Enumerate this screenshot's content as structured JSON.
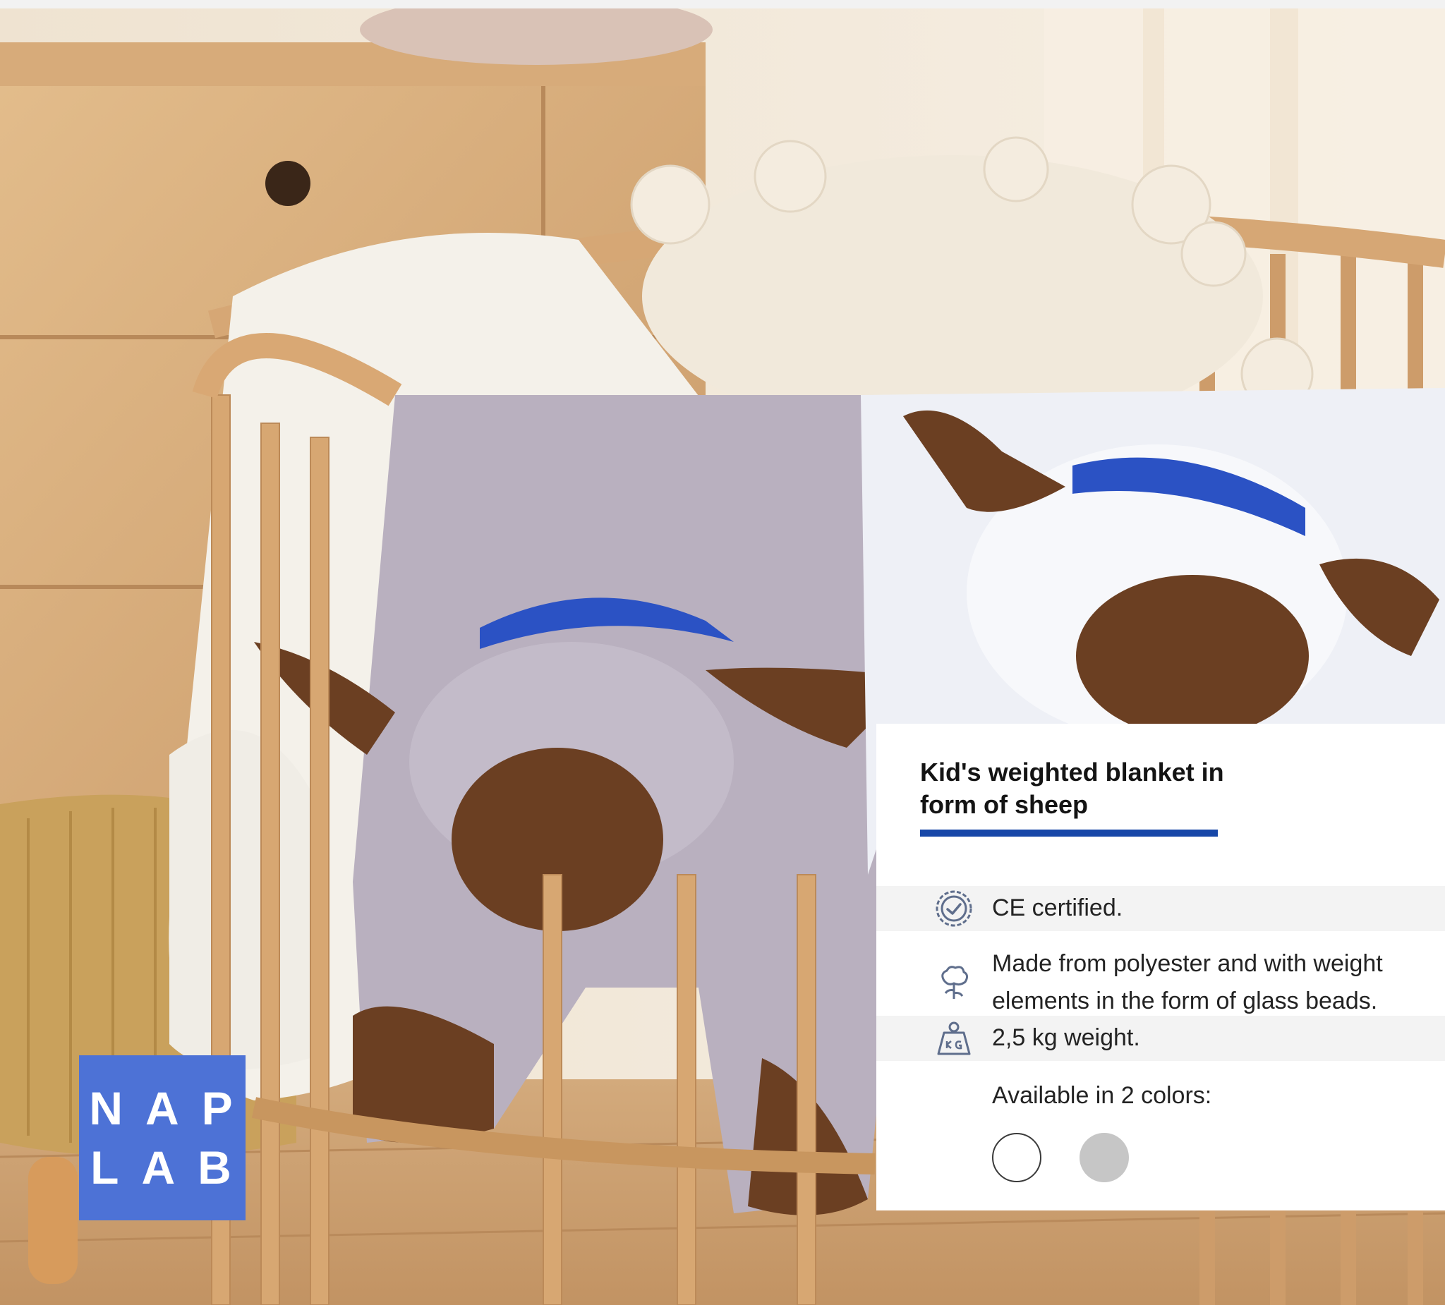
{
  "brand": {
    "line1": "NAP",
    "line2": "LAB",
    "color": "#4d72d6"
  },
  "product": {
    "title": "Kid's weighted blanket in form of sheep",
    "accent_color": "#1747a8",
    "features": [
      {
        "icon": "certified-badge-icon",
        "text": "CE certified."
      },
      {
        "icon": "cotton-plant-icon",
        "text": "Made from polyester and with weight elements in the form of glass beads."
      },
      {
        "icon": "weight-kg-icon",
        "text": "2,5 kg weight."
      }
    ],
    "colors_label": "Available in 2 colors:",
    "colors": [
      {
        "name": "white",
        "hex": "#ffffff"
      },
      {
        "name": "grey",
        "hex": "#c6c6c6"
      }
    ]
  }
}
